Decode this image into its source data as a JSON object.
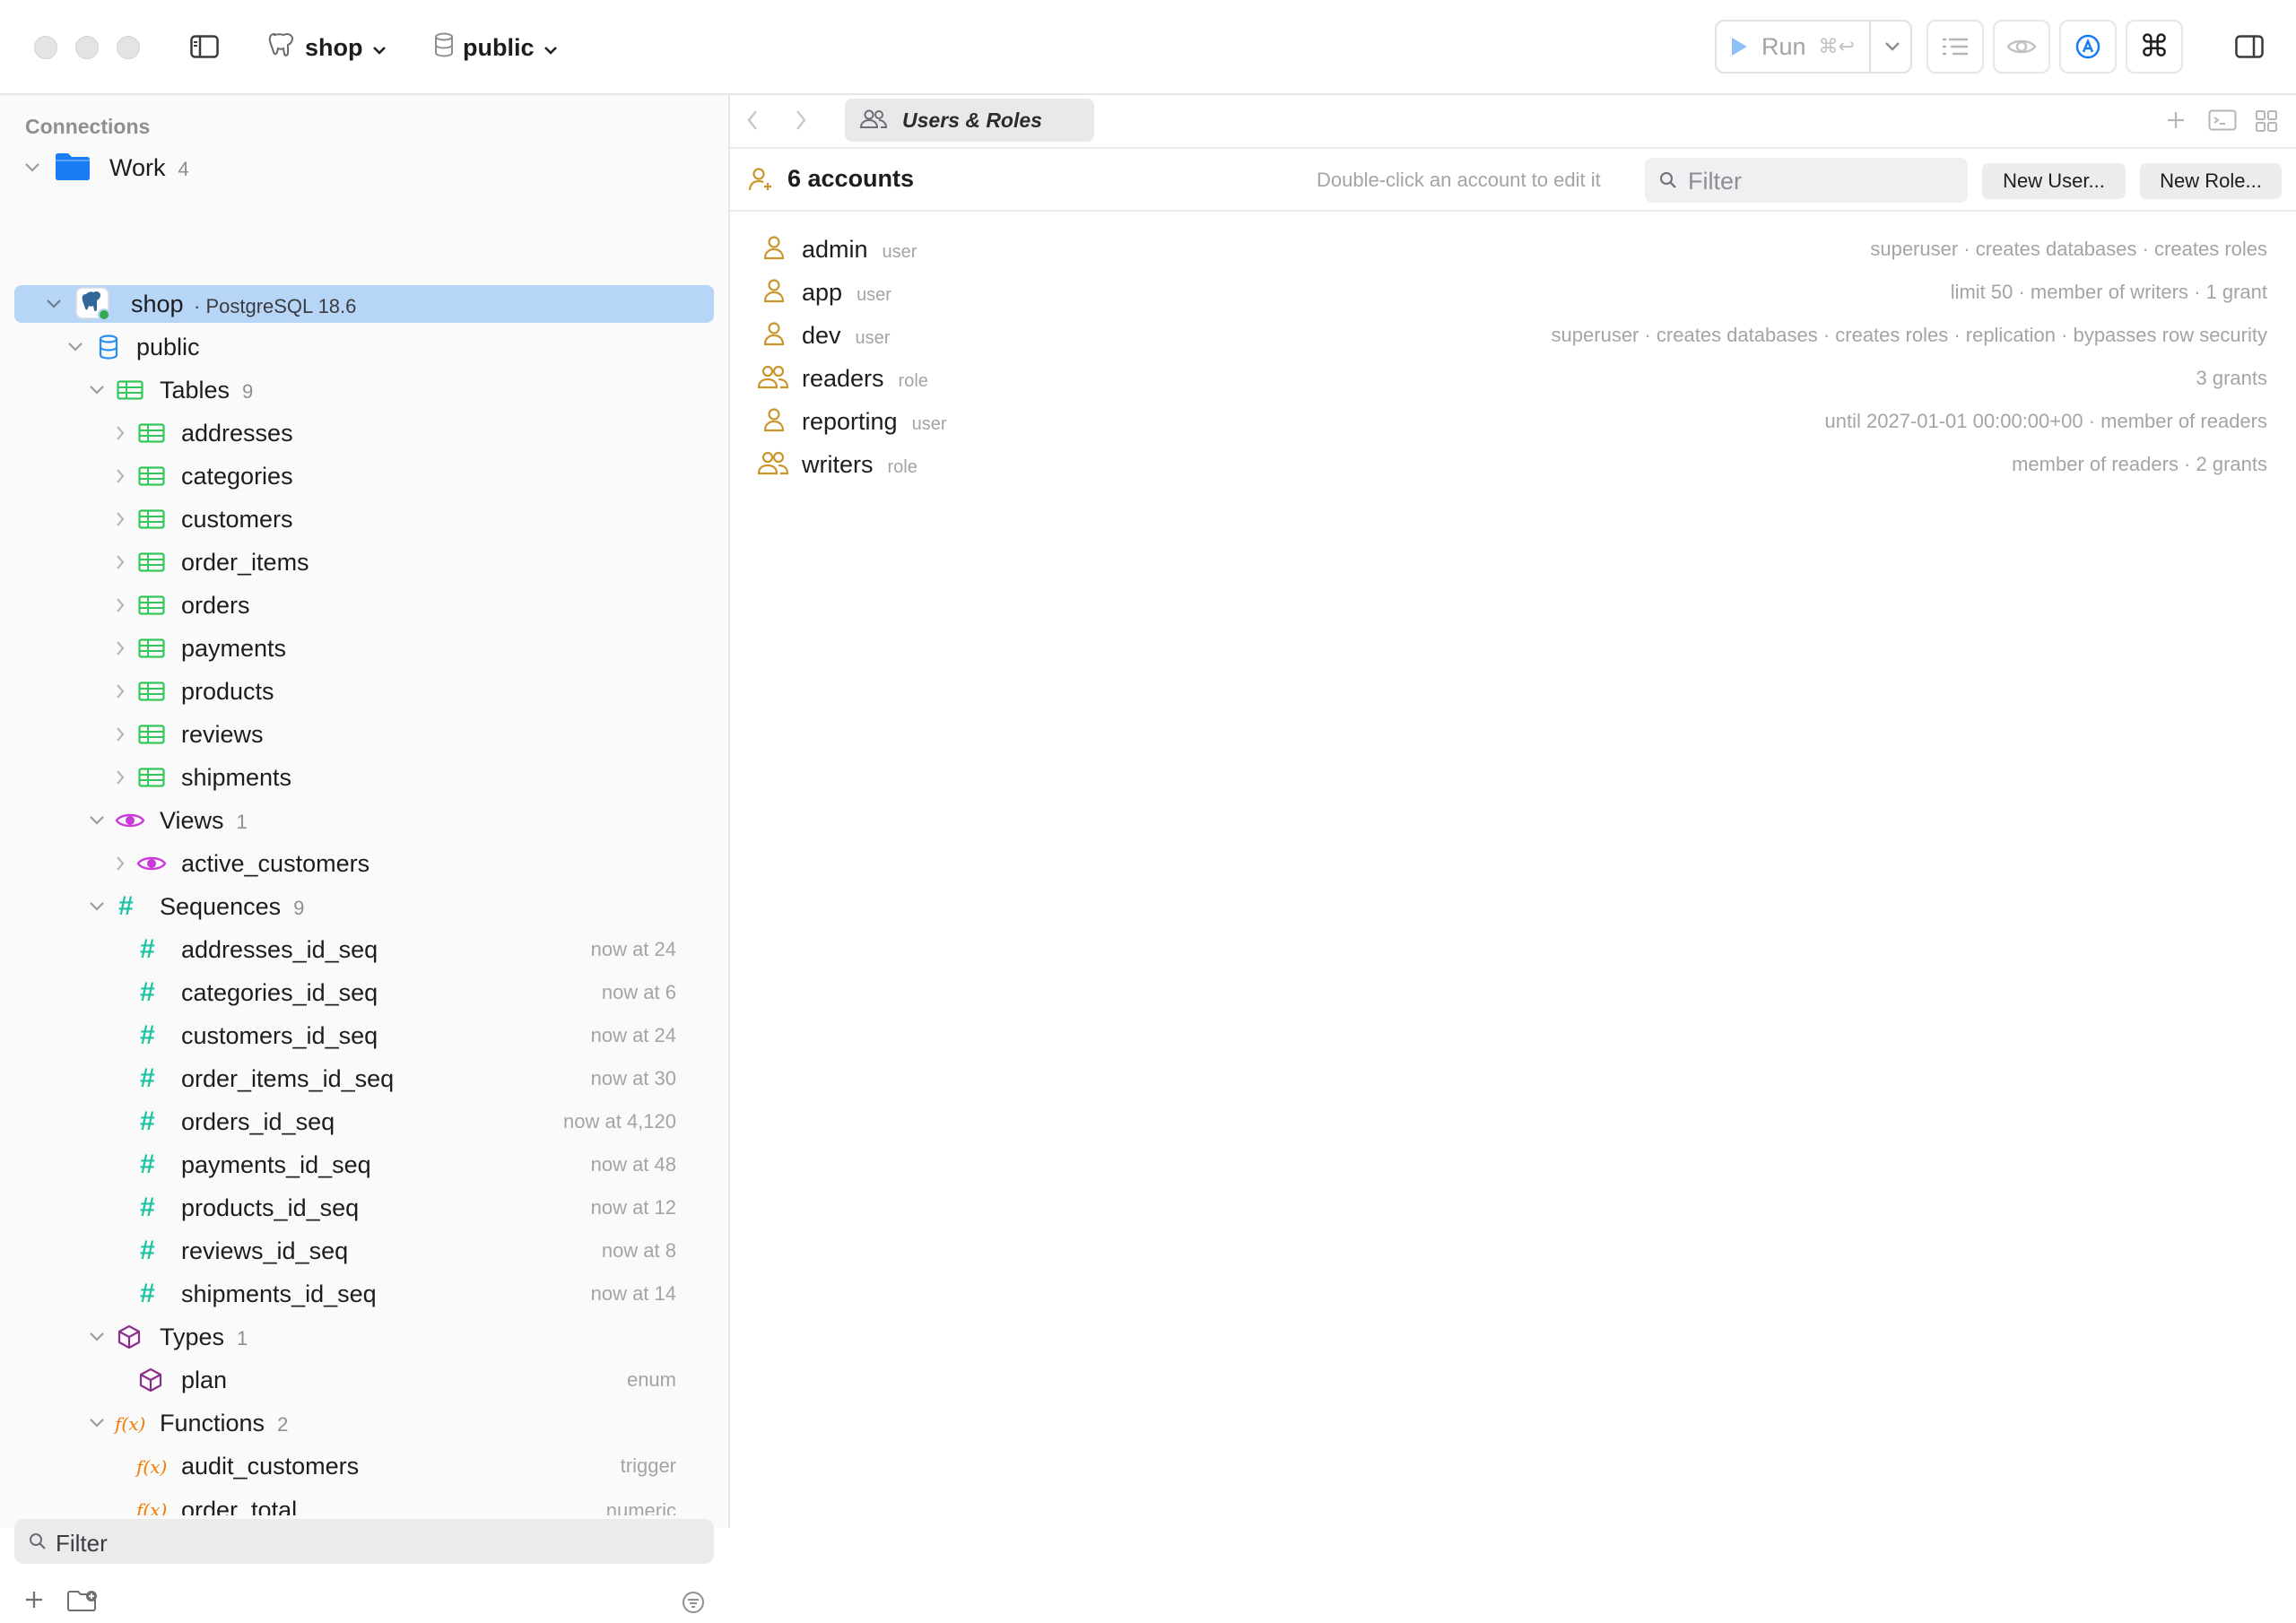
{
  "toolbar": {
    "connection_label": "shop",
    "schema_label": "public",
    "run_label": "Run",
    "run_shortcut": "⌘↩"
  },
  "sidebar": {
    "header": "Connections",
    "group": {
      "label": "Work",
      "count": "4"
    },
    "connection": {
      "label": "shop",
      "meta": "· PostgreSQL 18.6",
      "status_color": "#34a853"
    },
    "schema": {
      "label": "public"
    },
    "tables": {
      "label": "Tables",
      "count": "9",
      "items": [
        "addresses",
        "categories",
        "customers",
        "order_items",
        "orders",
        "payments",
        "products",
        "reviews",
        "shipments"
      ]
    },
    "views": {
      "label": "Views",
      "count": "1",
      "items": [
        "active_customers"
      ]
    },
    "sequences": {
      "label": "Sequences",
      "count": "9",
      "items": [
        {
          "name": "addresses_id_seq",
          "value": "now at 24"
        },
        {
          "name": "categories_id_seq",
          "value": "now at 6"
        },
        {
          "name": "customers_id_seq",
          "value": "now at 24"
        },
        {
          "name": "order_items_id_seq",
          "value": "now at 30"
        },
        {
          "name": "orders_id_seq",
          "value": "now at 4,120"
        },
        {
          "name": "payments_id_seq",
          "value": "now at 48"
        },
        {
          "name": "products_id_seq",
          "value": "now at 12"
        },
        {
          "name": "reviews_id_seq",
          "value": "now at 8"
        },
        {
          "name": "shipments_id_seq",
          "value": "now at 14"
        }
      ]
    },
    "types": {
      "label": "Types",
      "count": "1",
      "items": [
        {
          "name": "plan",
          "kind": "enum"
        }
      ]
    },
    "functions": {
      "label": "Functions",
      "count": "2",
      "items": [
        {
          "name": "audit_customers",
          "kind": "trigger"
        },
        {
          "name": "order_total",
          "kind": "numeric"
        }
      ]
    },
    "filter_placeholder": "Filter"
  },
  "main": {
    "tab_label": "Users & Roles",
    "accounts_count": "6 accounts",
    "hint": "Double-click an account to edit it",
    "filter_placeholder": "Filter",
    "new_user": "New User...",
    "new_role": "New Role...",
    "accounts": [
      {
        "name": "admin",
        "kind": "user",
        "desc": "superuser · creates databases · creates roles"
      },
      {
        "name": "app",
        "kind": "user",
        "desc": "limit 50 · member of writers · 1 grant"
      },
      {
        "name": "dev",
        "kind": "user",
        "desc": "superuser · creates databases · creates roles · replication · bypasses row security"
      },
      {
        "name": "readers",
        "kind": "role",
        "desc": "3 grants"
      },
      {
        "name": "reporting",
        "kind": "user",
        "desc": "until 2027-01-01 00:00:00+00 · member of readers"
      },
      {
        "name": "writers",
        "kind": "role",
        "desc": "member of readers · 2 grants"
      }
    ]
  },
  "colors": {
    "selection": "#b7d6f7",
    "table_icon": "#34c759",
    "view_icon": "#c93bd8",
    "sequence_icon": "#1fc2a7",
    "type_icon": "#8a2f8a",
    "function_icon": "#ef7c00",
    "account_icon": "#c9962b",
    "folder": "#1a7cf3",
    "schema_icon": "#2a8df0"
  }
}
